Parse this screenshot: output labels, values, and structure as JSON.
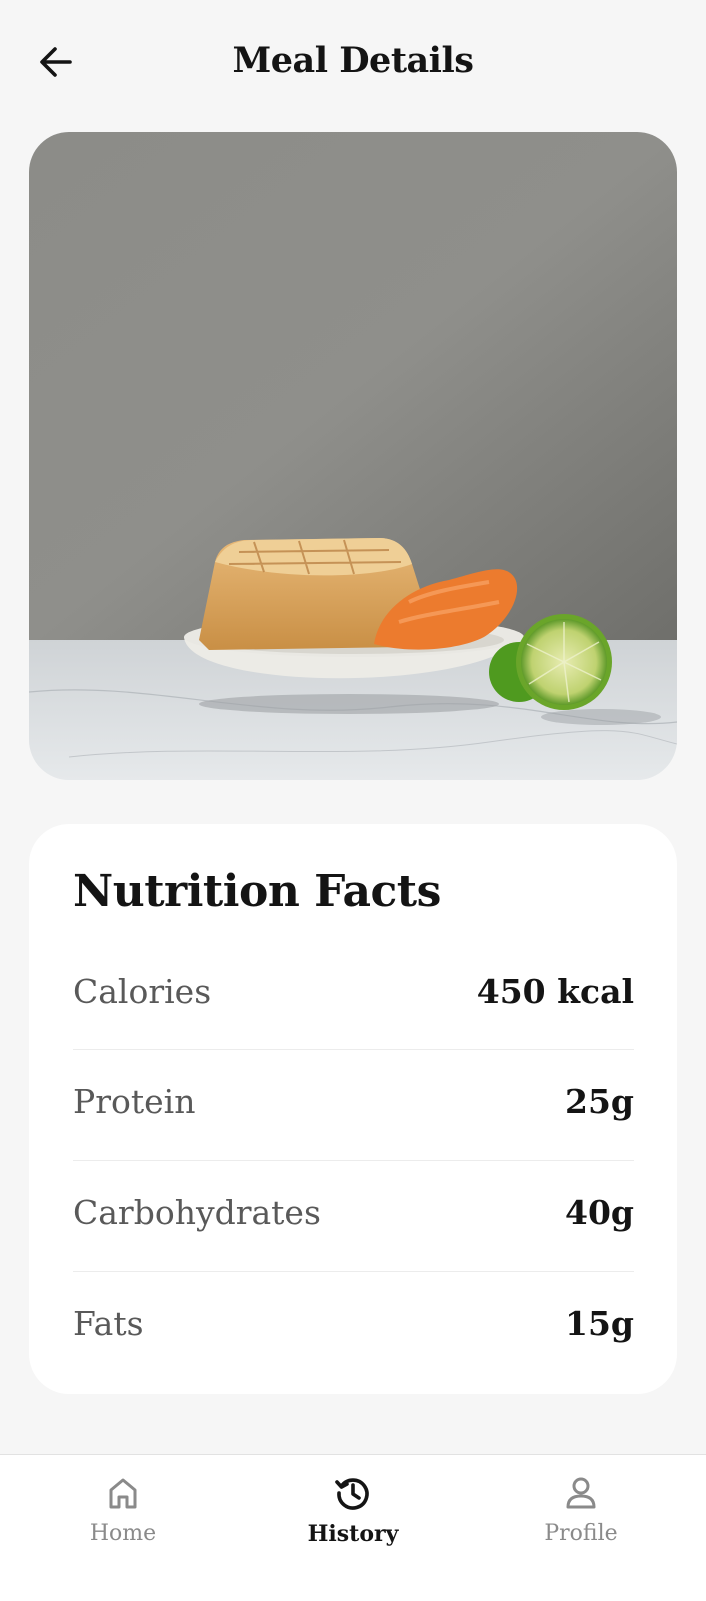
{
  "header": {
    "title": "Meal Details",
    "back_icon": "arrow-left-icon"
  },
  "nutrition": {
    "title": "Nutrition Facts",
    "rows": [
      {
        "label": "Calories",
        "value": "450 kcal"
      },
      {
        "label": "Protein",
        "value": "25g"
      },
      {
        "label": "Carbohydrates",
        "value": "40g"
      },
      {
        "label": "Fats",
        "value": "15g"
      }
    ]
  },
  "bottom_nav": {
    "items": [
      {
        "label": "Home",
        "icon": "home-icon",
        "active": false
      },
      {
        "label": "History",
        "icon": "history-icon",
        "active": true
      },
      {
        "label": "Profile",
        "icon": "profile-icon",
        "active": false
      }
    ]
  },
  "colors": {
    "background": "#f6f6f6",
    "card": "#ffffff",
    "text_primary": "#141414",
    "text_secondary": "#595959",
    "nav_inactive": "#8a8a8a"
  }
}
